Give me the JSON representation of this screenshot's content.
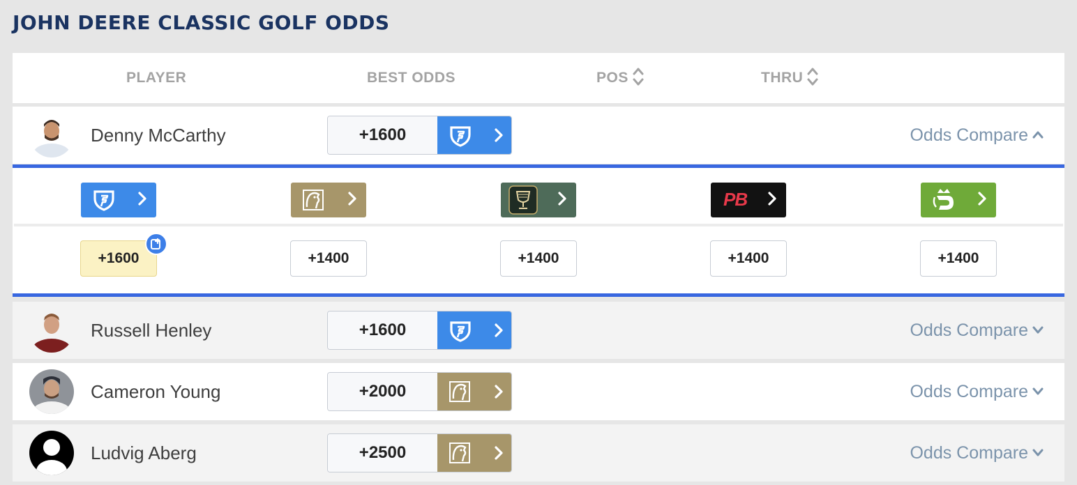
{
  "page_title": "JOHN DEERE CLASSIC GOLF ODDS",
  "columns": {
    "player": "PLAYER",
    "best_odds": "BEST ODDS",
    "pos": "POS",
    "thru": "THRU"
  },
  "compare_label": "Odds Compare",
  "players": [
    {
      "name": "Denny McCarthy",
      "best_odds": "+1600",
      "book": "fanduel",
      "expanded": true
    },
    {
      "name": "Russell Henley",
      "best_odds": "+1600",
      "book": "fanduel",
      "expanded": false
    },
    {
      "name": "Cameron Young",
      "best_odds": "+2000",
      "book": "betmgm",
      "expanded": false
    },
    {
      "name": "Ludvig Aberg",
      "best_odds": "+2500",
      "book": "betmgm",
      "expanded": false
    }
  ],
  "expanded_books": [
    {
      "book": "fanduel",
      "icon": "fanduel-shield-icon",
      "color": "#3d8ae8",
      "odds": "+1600",
      "best": true
    },
    {
      "book": "betmgm",
      "icon": "betmgm-lion-icon",
      "color": "#a7966a",
      "odds": "+1400",
      "best": false
    },
    {
      "book": "caesars",
      "icon": "caesars-trophy-icon",
      "color": "#4e6b59",
      "odds": "+1400",
      "best": false
    },
    {
      "book": "pointsbet",
      "icon": "pointsbet-pb-icon",
      "color": "#121212",
      "odds": "+1400",
      "best": false
    },
    {
      "book": "draftkings",
      "icon": "draftkings-crown-icon",
      "color": "#6faa39",
      "odds": "+1400",
      "best": false
    }
  ],
  "pointsbet_logo_text": "PB",
  "colors": {
    "title": "#1a3361",
    "accent_blue": "#3867e0",
    "fanduel": "#3d8ae8",
    "betmgm": "#a7966a"
  }
}
